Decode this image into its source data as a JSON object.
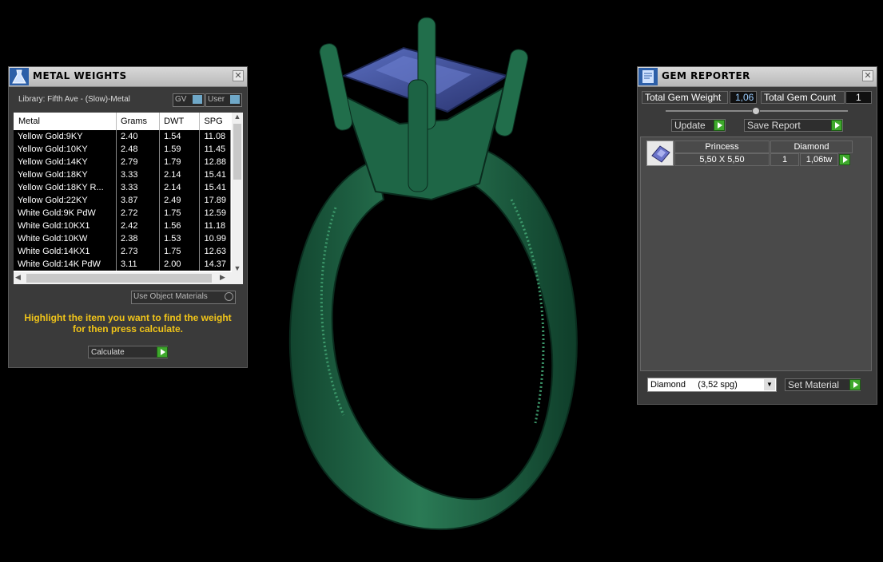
{
  "metal_weights": {
    "title": "METAL WEIGHTS",
    "library_label": "Library: Fifth Ave - (Slow)-Metal",
    "gv_label": "GV",
    "user_label": "User",
    "columns": [
      "Metal",
      "Grams",
      "DWT",
      "SPG"
    ],
    "rows": [
      [
        "Yellow Gold:9KY",
        "2.40",
        "1.54",
        "11.08"
      ],
      [
        "Yellow Gold:10KY",
        "2.48",
        "1.59",
        "11.45"
      ],
      [
        "Yellow Gold:14KY",
        "2.79",
        "1.79",
        "12.88"
      ],
      [
        "Yellow Gold:18KY",
        "3.33",
        "2.14",
        "15.41"
      ],
      [
        "Yellow Gold:18KY R...",
        "3.33",
        "2.14",
        "15.41"
      ],
      [
        "Yellow Gold:22KY",
        "3.87",
        "2.49",
        "17.89"
      ],
      [
        "White Gold:9K PdW",
        "2.72",
        "1.75",
        "12.59"
      ],
      [
        "White Gold:10KX1",
        "2.42",
        "1.56",
        "11.18"
      ],
      [
        "White Gold:10KW",
        "2.38",
        "1.53",
        "10.99"
      ],
      [
        "White Gold:14KX1",
        "2.73",
        "1.75",
        "12.63"
      ],
      [
        "White Gold:14K PdW",
        "3.11",
        "2.00",
        "14.37"
      ]
    ],
    "use_object_materials": "Use Object Materials",
    "instruction": "Highlight the item you want to find the weight for then press calculate.",
    "calculate_label": "Calculate"
  },
  "gem_reporter": {
    "title": "GEM REPORTER",
    "total_gem_weight_label": "Total Gem Weight",
    "total_gem_weight_value": "1,06",
    "total_gem_count_label": "Total Gem Count",
    "total_gem_count_value": "1",
    "update_label": "Update",
    "save_report_label": "Save Report",
    "gem": {
      "shape": "Princess",
      "material": "Diamond",
      "size": "5,50 X 5,50",
      "count": "1",
      "weight": "1,06tw"
    },
    "material_select": "Diamond     (3,52 spg)",
    "set_material_label": "Set Material"
  },
  "colors": {
    "ring_green": "#1f6b4a",
    "gem_blue": "#3c4f94",
    "button_green": "#3ea82c",
    "instruction_yellow": "#f0c419"
  }
}
